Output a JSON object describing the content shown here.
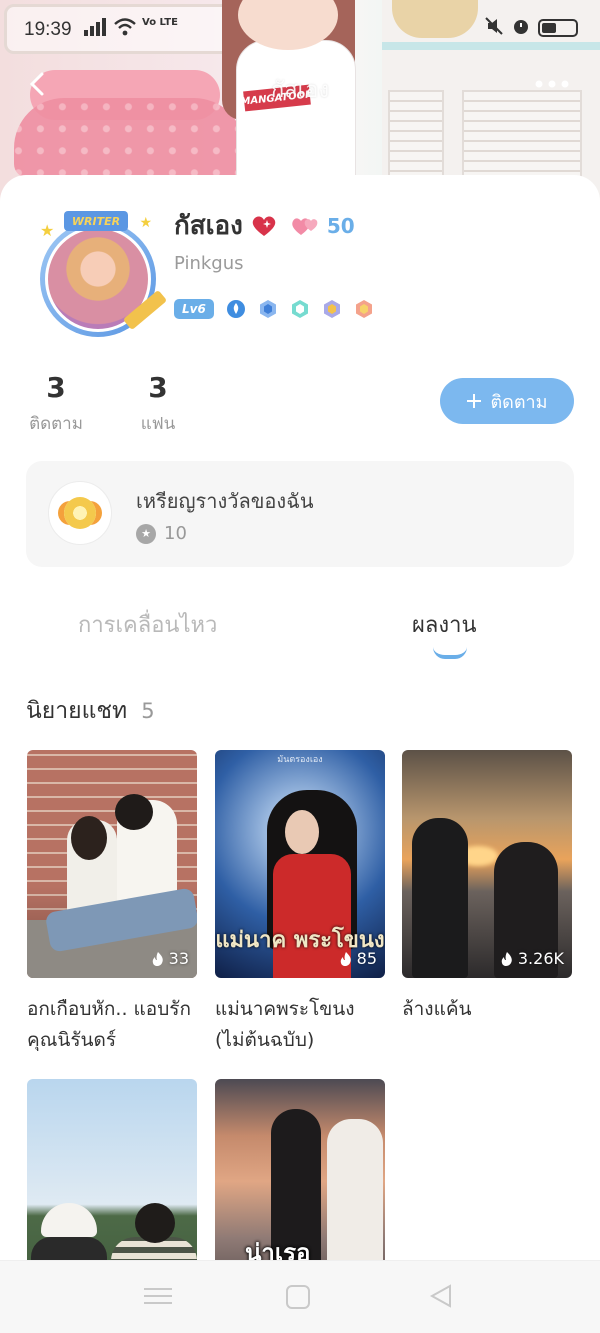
{
  "status_bar": {
    "time": "19:39",
    "network": "Vo LTE",
    "battery_badge": "0"
  },
  "header": {
    "title": "กัสเอง"
  },
  "banner": {
    "shirt_logo": "MANGATOON",
    "colors": {
      "bed": "#ef8fa2",
      "shelf": "#f4f1ef"
    }
  },
  "profile": {
    "writer_tag": "WRITER",
    "display_name": "กัสเอง",
    "love_count": "50",
    "username": "Pinkgus",
    "level": "Lv6",
    "badge_icons": [
      "flame-badge-icon",
      "blue-hex-badge-icon",
      "teal-hex-badge-icon",
      "purple-hex-badge-icon",
      "orange-hex-badge-icon"
    ]
  },
  "stats": [
    {
      "value": "3",
      "label": "ติดตาม"
    },
    {
      "value": "3",
      "label": "แฟน"
    }
  ],
  "follow_button": {
    "label": "ติดตาม",
    "icon": "plus-icon"
  },
  "medals": {
    "title": "เหรียญรางวัลของฉัน",
    "count": "10"
  },
  "tabs": [
    {
      "label": "การเคลื่อนไหว",
      "active": false
    },
    {
      "label": "ผลงาน",
      "active": true
    }
  ],
  "section": {
    "title": "นิยายแชท",
    "count": "5"
  },
  "works": [
    {
      "title": "อกเกือบหัก.. แอบรักคุณนิรันดร์",
      "heat": "33"
    },
    {
      "title": "แม่นาคพระโขนง (ไม่ต้นฉบับ)",
      "heat": "85",
      "cover_text": "แม่นาค พระโขนง",
      "cover_top_text": "มันตรองเอง"
    },
    {
      "title": "ล้างแค้น",
      "heat": "3.26K"
    },
    {
      "title": "",
      "heat": ""
    },
    {
      "title": "",
      "heat": "",
      "cover_text": "น่าเรอ"
    }
  ],
  "colors": {
    "accent": "#6aaee8",
    "follow_button": "#7cb8ef",
    "text_primary": "#333333",
    "text_muted": "#999999"
  }
}
